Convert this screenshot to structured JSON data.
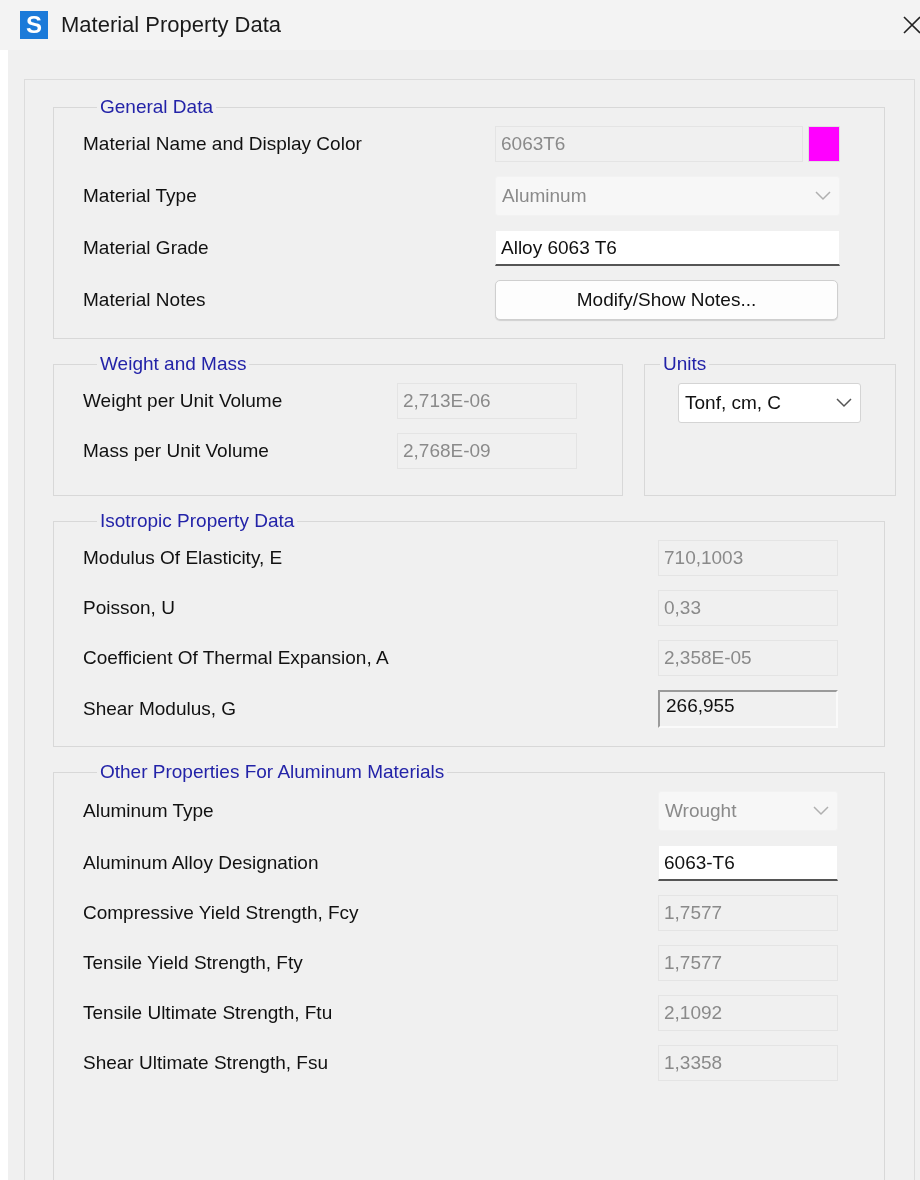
{
  "window": {
    "app_icon": "S",
    "title": "Material Property Data"
  },
  "general_data": {
    "title": "General Data",
    "rows": [
      {
        "label": "Material Name and Display Color",
        "kind": "text",
        "value": "6063T6",
        "disabled": true,
        "color": "#ff00ff"
      },
      {
        "label": "Material Type",
        "kind": "dropdown",
        "value": "Aluminum",
        "disabled": true
      },
      {
        "label": "Material Grade",
        "kind": "text",
        "value": "Alloy 6063 T6",
        "disabled": false
      },
      {
        "label": "Material Notes",
        "kind": "button",
        "value": "Modify/Show Notes...",
        "disabled": false
      }
    ]
  },
  "weight_and_mass": {
    "title": "Weight and Mass",
    "rows": [
      {
        "label": "Weight per Unit Volume",
        "kind": "text",
        "value": "2,713E-06",
        "disabled": true
      },
      {
        "label": "Mass per Unit Volume",
        "kind": "text",
        "value": "2,768E-09",
        "disabled": true
      }
    ]
  },
  "units": {
    "title": "Units",
    "value": "Tonf, cm, C",
    "disabled": false
  },
  "isotropic_property_data": {
    "title": "Isotropic Property Data",
    "rows": [
      {
        "label": "Modulus Of Elasticity,  E",
        "kind": "text",
        "value": "710,1003",
        "disabled": true
      },
      {
        "label": "Poisson, U",
        "kind": "text",
        "value": "0,33",
        "disabled": true
      },
      {
        "label": "Coefficient Of Thermal Expansion,  A",
        "kind": "text",
        "value": "2,358E-05",
        "disabled": true
      },
      {
        "label": "Shear Modulus,  G",
        "kind": "sunken",
        "value": "266,955",
        "disabled": false
      }
    ]
  },
  "other_properties": {
    "title": "Other Properties For Aluminum Materials",
    "rows": [
      {
        "label": "Aluminum Type",
        "kind": "dropdown",
        "value": "Wrought",
        "disabled": true
      },
      {
        "label": "Aluminum Alloy Designation",
        "kind": "text",
        "value": "6063-T6",
        "disabled": false
      },
      {
        "label": "Compressive Yield Strength, Fcy",
        "kind": "text",
        "value": "1,7577",
        "disabled": true
      },
      {
        "label": "Tensile Yield Strength, Fty",
        "kind": "text",
        "value": "1,7577",
        "disabled": true
      },
      {
        "label": "Tensile Ultimate Strength, Ftu",
        "kind": "text",
        "value": "2,1092",
        "disabled": true
      },
      {
        "label": "Shear Ultimate Strength, Fsu",
        "kind": "text",
        "value": "1,3358",
        "disabled": true
      }
    ]
  }
}
